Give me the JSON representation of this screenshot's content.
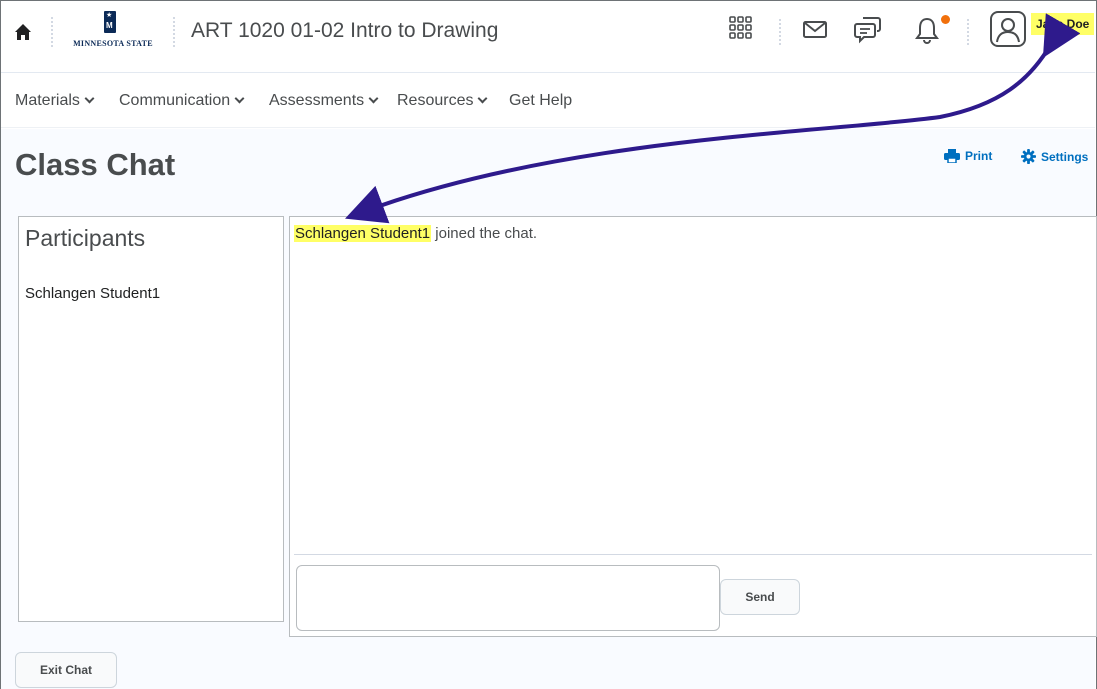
{
  "header": {
    "org_name": "MINNESOTA STATE",
    "course_title": "ART 1020 01-02 Intro to Drawing",
    "user_name": "Jane Doe"
  },
  "nav": {
    "items": [
      {
        "label": "Materials",
        "has_menu": true
      },
      {
        "label": "Communication",
        "has_menu": true
      },
      {
        "label": "Assessments",
        "has_menu": true
      },
      {
        "label": "Resources",
        "has_menu": true
      },
      {
        "label": "Get Help",
        "has_menu": false
      }
    ]
  },
  "page": {
    "title": "Class Chat",
    "print_label": "Print",
    "settings_label": "Settings"
  },
  "participants": {
    "heading": "Participants",
    "items": [
      "Schlangen Student1"
    ]
  },
  "chat": {
    "messages": [
      {
        "user": "Schlangen Student1",
        "text": "joined the chat."
      }
    ],
    "input_value": "",
    "send_label": "Send"
  },
  "exit_label": "Exit Chat",
  "colors": {
    "highlight": "#ffff66",
    "annotation_arrow": "#2e1a8c",
    "link": "#006fbf",
    "notification": "#f1700c",
    "brand_navy": "#0b2a57"
  },
  "icons": [
    "home-icon",
    "apps-grid-icon",
    "mail-icon",
    "chat-bubbles-icon",
    "bell-icon",
    "user-avatar-icon",
    "printer-icon",
    "gear-icon"
  ]
}
